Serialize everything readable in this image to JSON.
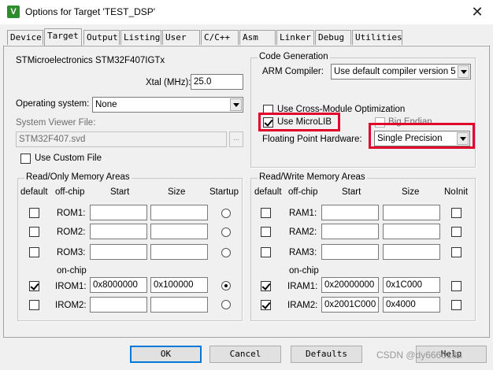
{
  "window": {
    "title": "Options for Target 'TEST_DSP'",
    "app_icon": "keil-uvision-icon",
    "close_glyph": "✕"
  },
  "tabs": [
    "Device",
    "Target",
    "Output",
    "Listing",
    "User",
    "C/C++",
    "Asm",
    "Linker",
    "Debug",
    "Utilities"
  ],
  "active_tab": "Target",
  "target": {
    "device_name": "STMicroelectronics STM32F407IGTx",
    "xtal_label": "Xtal (MHz):",
    "xtal_value": "25.0",
    "os_label": "Operating system:",
    "os_value": "None",
    "svd_label": "System Viewer File:",
    "svd_value": "STM32F407.svd",
    "browse_label": "...",
    "custom_file_label": "Use Custom File"
  },
  "code_gen": {
    "group_title": "Code Generation",
    "compiler_label": "ARM Compiler:",
    "compiler_value": "Use default compiler version 5",
    "cross_module_label": "Use Cross-Module Optimization",
    "microlib_label": "Use MicroLIB",
    "microlib_checked": true,
    "big_endian_label": "Big Endian",
    "fpu_label": "Floating Point Hardware:",
    "fpu_value": "Single Precision"
  },
  "rom": {
    "group_title": "Read/Only Memory Areas",
    "headers": {
      "default": "default",
      "offchip": "off-chip",
      "start": "Start",
      "size": "Size",
      "startup": "Startup"
    },
    "onchip_label": "on-chip",
    "rows": [
      {
        "name": "ROM1:",
        "start": "",
        "size": "",
        "default": false,
        "startup": false
      },
      {
        "name": "ROM2:",
        "start": "",
        "size": "",
        "default": false,
        "startup": false
      },
      {
        "name": "ROM3:",
        "start": "",
        "size": "",
        "default": false,
        "startup": false
      },
      {
        "name": "IROM1:",
        "start": "0x8000000",
        "size": "0x100000",
        "default": true,
        "startup": true
      },
      {
        "name": "IROM2:",
        "start": "",
        "size": "",
        "default": false,
        "startup": false
      }
    ]
  },
  "ram": {
    "group_title": "Read/Write Memory Areas",
    "headers": {
      "default": "default",
      "offchip": "off-chip",
      "start": "Start",
      "size": "Size",
      "noinit": "NoInit"
    },
    "onchip_label": "on-chip",
    "rows": [
      {
        "name": "RAM1:",
        "start": "",
        "size": "",
        "default": false,
        "noinit": false
      },
      {
        "name": "RAM2:",
        "start": "",
        "size": "",
        "default": false,
        "noinit": false
      },
      {
        "name": "RAM3:",
        "start": "",
        "size": "",
        "default": false,
        "noinit": false
      },
      {
        "name": "IRAM1:",
        "start": "0x20000000",
        "size": "0x1C000",
        "default": true,
        "noinit": false
      },
      {
        "name": "IRAM2:",
        "start": "0x2001C000",
        "size": "0x4000",
        "default": true,
        "noinit": false
      }
    ]
  },
  "buttons": {
    "ok": "OK",
    "cancel": "Cancel",
    "defaults": "Defaults",
    "help": "Help"
  },
  "watermark": "CSDN @dy6660188",
  "colors": {
    "highlight": "#e0002a",
    "default_button_border": "#0078d7"
  }
}
